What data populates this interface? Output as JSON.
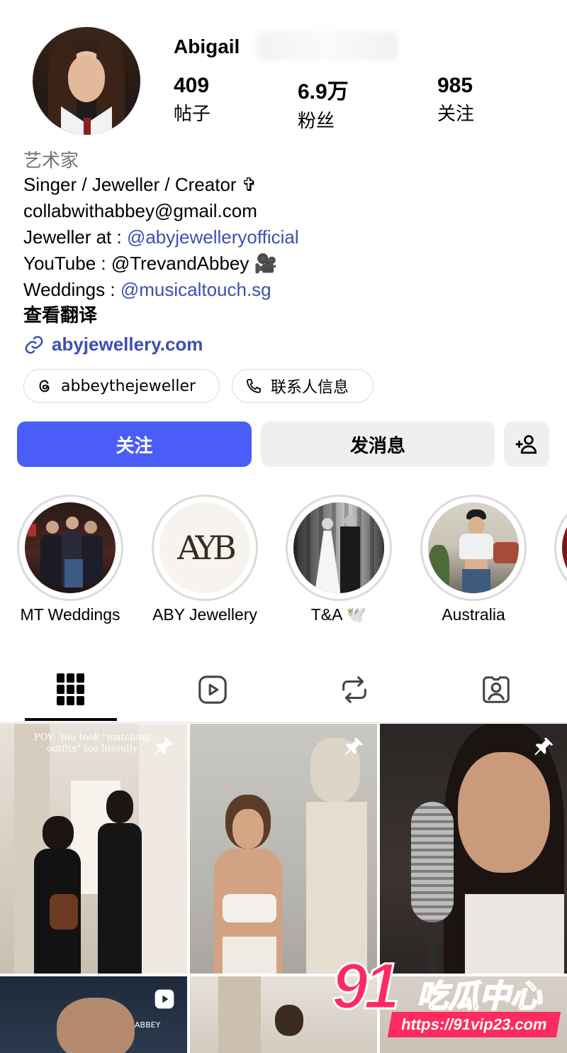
{
  "profile": {
    "username": "Abigail",
    "stats": [
      {
        "value": "409",
        "label": "帖子"
      },
      {
        "value": "6.9万",
        "label": "粉丝"
      },
      {
        "value": "985",
        "label": "关注"
      }
    ],
    "category": "艺术家",
    "bio": {
      "line1": "Singer / Jeweller / Creator ✞",
      "line2": "collabwithabbey@gmail.com",
      "line3_prefix": "Jeweller at : ",
      "line3_link": "@abyjewelleryofficial",
      "line4": "YouTube : @TrevandAbbey 🎥",
      "line5_prefix": "Weddings : ",
      "line5_link": "@musicaltouch.sg"
    },
    "translate": "查看翻译",
    "website": "abyjewellery.com"
  },
  "chips": {
    "threads": "abbeythejeweller",
    "contact": "联系人信息"
  },
  "actions": {
    "follow": "关注",
    "message": "发消息"
  },
  "highlights": [
    {
      "label": "MT Weddings"
    },
    {
      "label": "ABY Jewellery",
      "logo": "AYB"
    },
    {
      "label": "T&A 🕊️"
    },
    {
      "label": "Australia"
    }
  ],
  "posts": {
    "tile1_caption": "POV: You took \"matching outfits\" too literally",
    "tile4_caption": "ABBEY"
  },
  "watermark": {
    "big": "91",
    "cn": "吃瓜中心",
    "url": "https://91vip23.com"
  },
  "colors": {
    "accent": "#4a5df9",
    "link": "#3d4fb3",
    "watermark": "#ff2a5f"
  }
}
